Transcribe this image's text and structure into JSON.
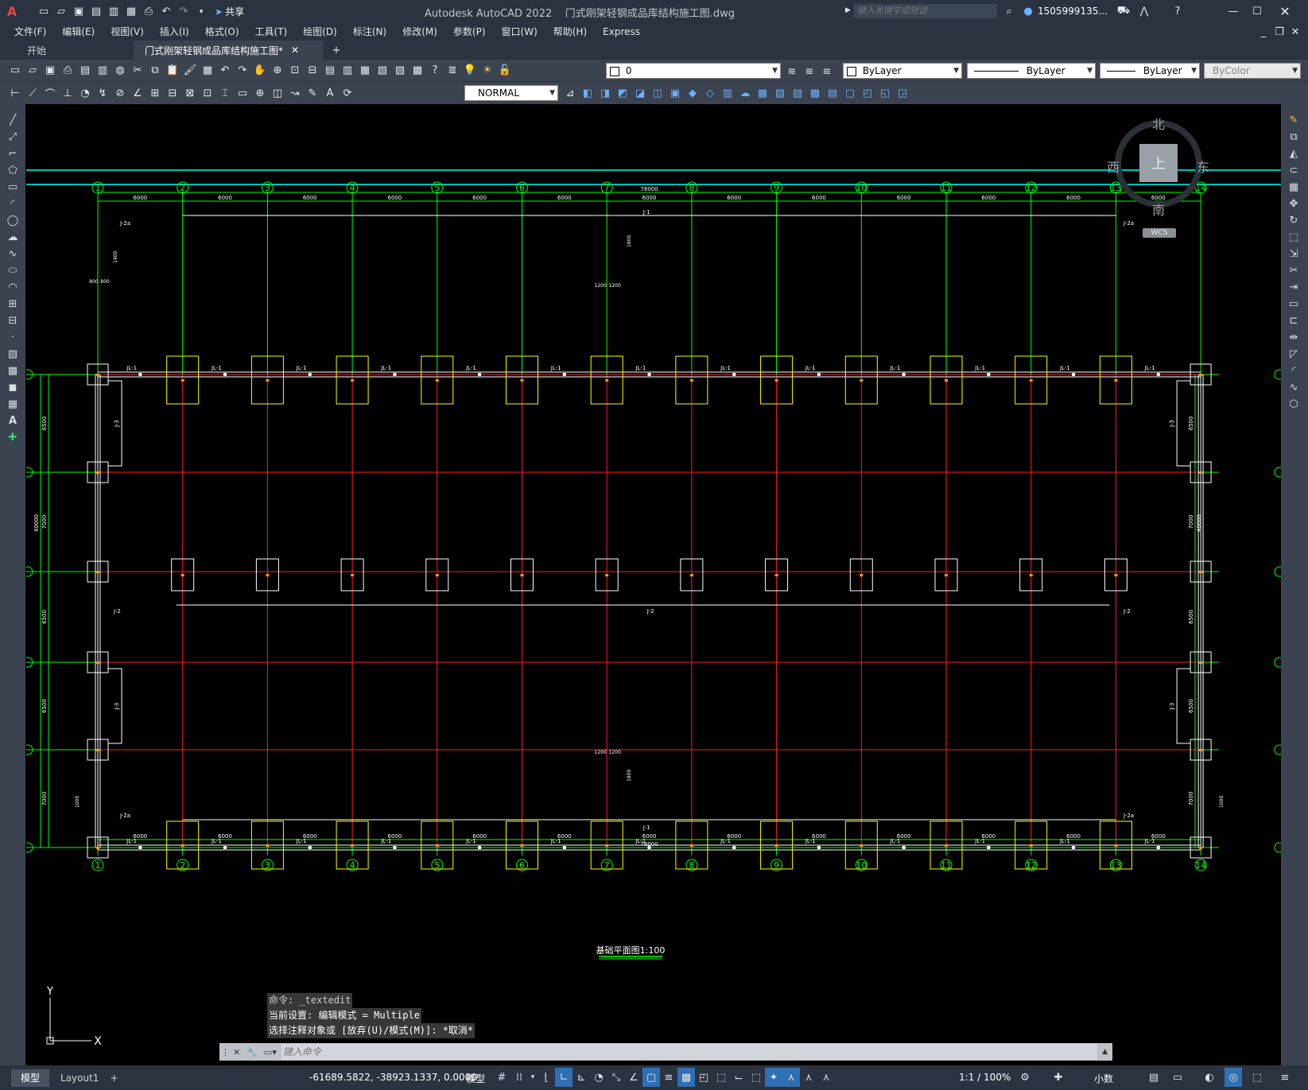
{
  "app": {
    "title": "Autodesk AutoCAD 2022    门式刚架轻钢成品库结构施工图.dwg",
    "search_placeholder": "键入关键字或短语",
    "user": "1505999135...",
    "share_label": "共享"
  },
  "menu": [
    "文件(F)",
    "编辑(E)",
    "视图(V)",
    "插入(I)",
    "格式(O)",
    "工具(T)",
    "绘图(D)",
    "标注(N)",
    "修改(M)",
    "参数(P)",
    "窗口(W)",
    "帮助(H)",
    "Express"
  ],
  "tabs": [
    {
      "label": "开始",
      "active": false
    },
    {
      "label": "门式刚架轻钢成品库结构施工图*",
      "active": true
    }
  ],
  "layer": {
    "name": "0"
  },
  "props": {
    "color": "ByLayer",
    "linetype": "ByLayer",
    "lineweight": "ByLayer",
    "plotstyle": "ByColor"
  },
  "textstyle": {
    "value": "NORMAL"
  },
  "viewcube": {
    "north": "北",
    "south": "南",
    "east": "东",
    "west": "西",
    "top": "上",
    "wcs": "WCS"
  },
  "drawing": {
    "title": "基础平面图1:100",
    "col_labels": [
      "1",
      "2",
      "3",
      "4",
      "5",
      "6",
      "7",
      "8",
      "9",
      "10",
      "11",
      "12",
      "13",
      "14"
    ],
    "span_dims": [
      "6000",
      "6000",
      "6000",
      "6000",
      "6000",
      "6000",
      "6000",
      "6000",
      "6000",
      "6000",
      "6000",
      "6000",
      "6000"
    ],
    "total_width": "78000",
    "row_dims": [
      "6500",
      "7000",
      "6500",
      "6500",
      "7000",
      "6500"
    ],
    "total_height": "40000",
    "beam_labels": {
      "jl1": "JL-1",
      "j1": "J-1",
      "j2": "J-2",
      "j2a": "J-2a",
      "j3": "J-3"
    },
    "footing_dims": {
      "d1200": "1200",
      "d1800": "1800",
      "d800": "800",
      "d1400": "1400",
      "d1000": "1000"
    }
  },
  "command": {
    "lines": [
      "命令: _textedit",
      "当前设置: 编辑模式 = Multiple",
      "选择注释对象或 [放弃(U)/模式(M)]: *取消*"
    ],
    "placeholder": "键入命令"
  },
  "status": {
    "model_tab": "模型",
    "layout_tab": "Layout1",
    "coords": "-61689.5822, -38923.1337, 0.0000",
    "mode": "模型",
    "scale": "1:1 / 100%",
    "units": "小数"
  },
  "colors": {
    "axis_red": "#ff2020",
    "dim_green": "#00ff00",
    "footing_yellow": "#ffff00",
    "cyan": "#00ffff",
    "white": "#ffffff",
    "ui_dark": "#2b3340",
    "ui_mid": "#3b4350"
  }
}
